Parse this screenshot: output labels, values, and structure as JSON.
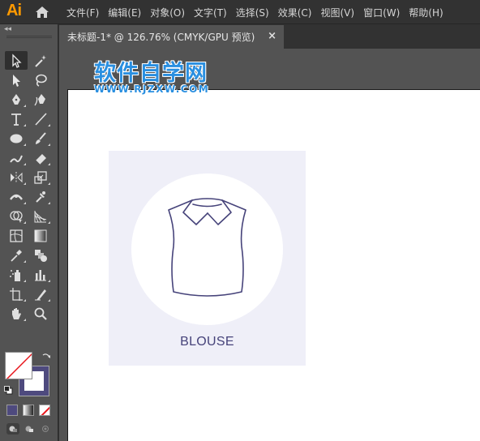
{
  "app": {
    "logo": "Ai"
  },
  "menu": [
    "文件(F)",
    "编辑(E)",
    "对象(O)",
    "文字(T)",
    "选择(S)",
    "效果(C)",
    "视图(V)",
    "窗口(W)",
    "帮助(H)"
  ],
  "document_tab": {
    "title": "未标题-1* @ 126.76% (CMYK/GPU 预览)",
    "close": "×"
  },
  "toolbox": {
    "collapse": "◂◂",
    "tools": [
      "selection-tool",
      "magic-wand-tool",
      "direct-selection-tool",
      "lasso-tool",
      "pen-tool",
      "curvature-tool",
      "type-tool",
      "line-segment-tool",
      "ellipse-tool",
      "paintbrush-tool",
      "shaper-tool",
      "eraser-tool",
      "reflect-tool",
      "scale-tool",
      "width-tool",
      "puppet-warp-tool",
      "shape-builder-tool",
      "perspective-grid-tool",
      "mesh-tool",
      "gradient-tool",
      "eyedropper-tool",
      "blend-tool",
      "symbol-sprayer-tool",
      "column-graph-tool",
      "artboard-tool",
      "slice-tool",
      "hand-tool",
      "zoom-tool"
    ],
    "fill_color": "#ffffff",
    "stroke_color": "#4e4a7e"
  },
  "artwork": {
    "label": "BLOUSE",
    "background_color": "#efeff8",
    "stroke_color": "#46437a"
  },
  "watermark": {
    "title": "软件自学网",
    "url": "WWW.RJZXW.COM"
  }
}
